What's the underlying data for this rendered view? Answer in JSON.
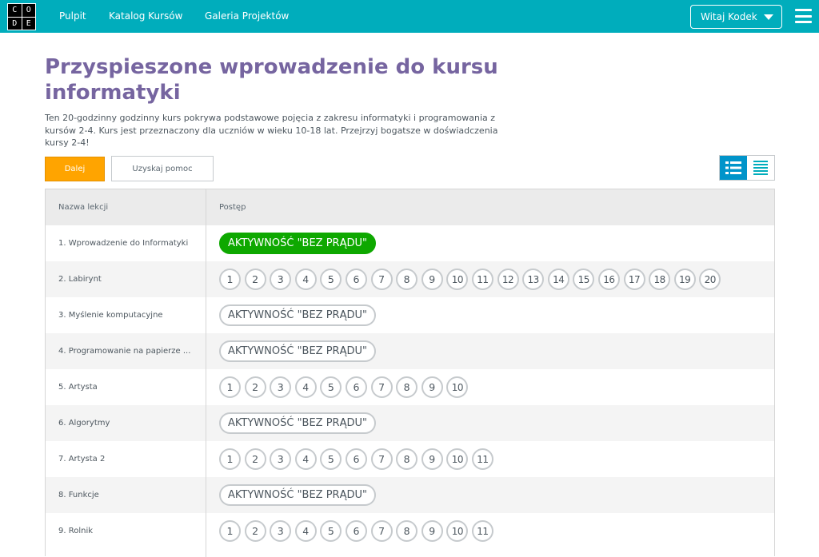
{
  "header": {
    "logo_letters": [
      "C",
      "O",
      "D",
      "E"
    ],
    "nav": [
      "Pulpit",
      "Katalog Kursów",
      "Galeria Projektów"
    ],
    "user_button": "Witaj Kodek",
    "accent_color": "#00adbc"
  },
  "course": {
    "title": "Przyspieszone wprowadzenie do kursu informatyki",
    "description": "Ten 20-godzinny godzinny kurs pokrywa podstawowe pojęcia z zakresu informatyki i programowania z kursów 2-4. Kurs jest przeznaczony dla uczniów w wieku 10-18 lat. Przejrzyj bogatsze w doświadczenia kursy 2-4!",
    "next_button": "Dalej",
    "help_button": "Uzyskaj pomoc",
    "view_modes": [
      "list-detail-icon",
      "list-compact-icon"
    ],
    "active_view": "list-detail-icon"
  },
  "table": {
    "headers": [
      "Nazwa lekcji",
      "Postęp"
    ],
    "lessons": [
      {
        "name": "1. Wprowadzenie do Informatyki",
        "type": "unplugged",
        "label": "AKTYWNOŚĆ \"BEZ PRĄDU\"",
        "completed": true
      },
      {
        "name": "2. Labirynt",
        "type": "levels",
        "levels": [
          "1",
          "2",
          "3",
          "4",
          "5",
          "6",
          "7",
          "8",
          "9",
          "10",
          "11",
          "12",
          "13",
          "14",
          "15",
          "16",
          "17",
          "18",
          "19",
          "20"
        ]
      },
      {
        "name": "3. Myślenie komputacyjne",
        "type": "unplugged",
        "label": "AKTYWNOŚĆ \"BEZ PRĄDU\"",
        "completed": false
      },
      {
        "name": "4. Programowanie na papierze ...",
        "type": "unplugged",
        "label": "AKTYWNOŚĆ \"BEZ PRĄDU\"",
        "completed": false
      },
      {
        "name": "5. Artysta",
        "type": "levels",
        "levels": [
          "1",
          "2",
          "3",
          "4",
          "5",
          "6",
          "7",
          "8",
          "9",
          "10"
        ]
      },
      {
        "name": "6. Algorytmy",
        "type": "unplugged",
        "label": "AKTYWNOŚĆ \"BEZ PRĄDU\"",
        "completed": false
      },
      {
        "name": "7. Artysta 2",
        "type": "levels",
        "levels": [
          "1",
          "2",
          "3",
          "4",
          "5",
          "6",
          "7",
          "8",
          "9",
          "10",
          "11"
        ]
      },
      {
        "name": "8. Funkcje",
        "type": "unplugged",
        "label": "AKTYWNOŚĆ \"BEZ PRĄDU\"",
        "completed": false
      },
      {
        "name": "9. Rolnik",
        "type": "levels",
        "levels": [
          "1",
          "2",
          "3",
          "4",
          "5",
          "6",
          "7",
          "8",
          "9",
          "10",
          "11"
        ]
      }
    ]
  }
}
